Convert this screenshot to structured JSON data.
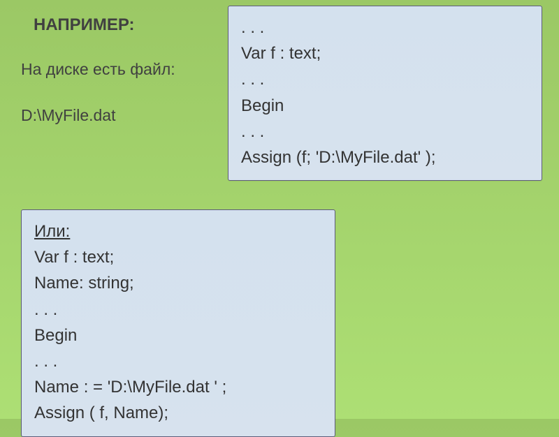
{
  "header": "НАПРИМЕР:",
  "sublabel": "На диске есть файл:",
  "filename": "D:\\MyFile.dat",
  "code_top": {
    "l1": ". . .",
    "l2": "Var f : text;",
    "l3": ". . .",
    "l4": "Begin",
    "l5": ". . .",
    "l6": "Assign (f; 'D:\\MyFile.dat' );"
  },
  "code_bottom": {
    "l1": "Или:",
    "l2": "Var f : text;",
    "l3": "Name: string;",
    "l4": ". . .",
    "l5": "Begin",
    "l6": ". . .",
    "l7": "Name : = 'D:\\MyFile.dat ' ;",
    "l8": "Assign ( f, Name);"
  }
}
